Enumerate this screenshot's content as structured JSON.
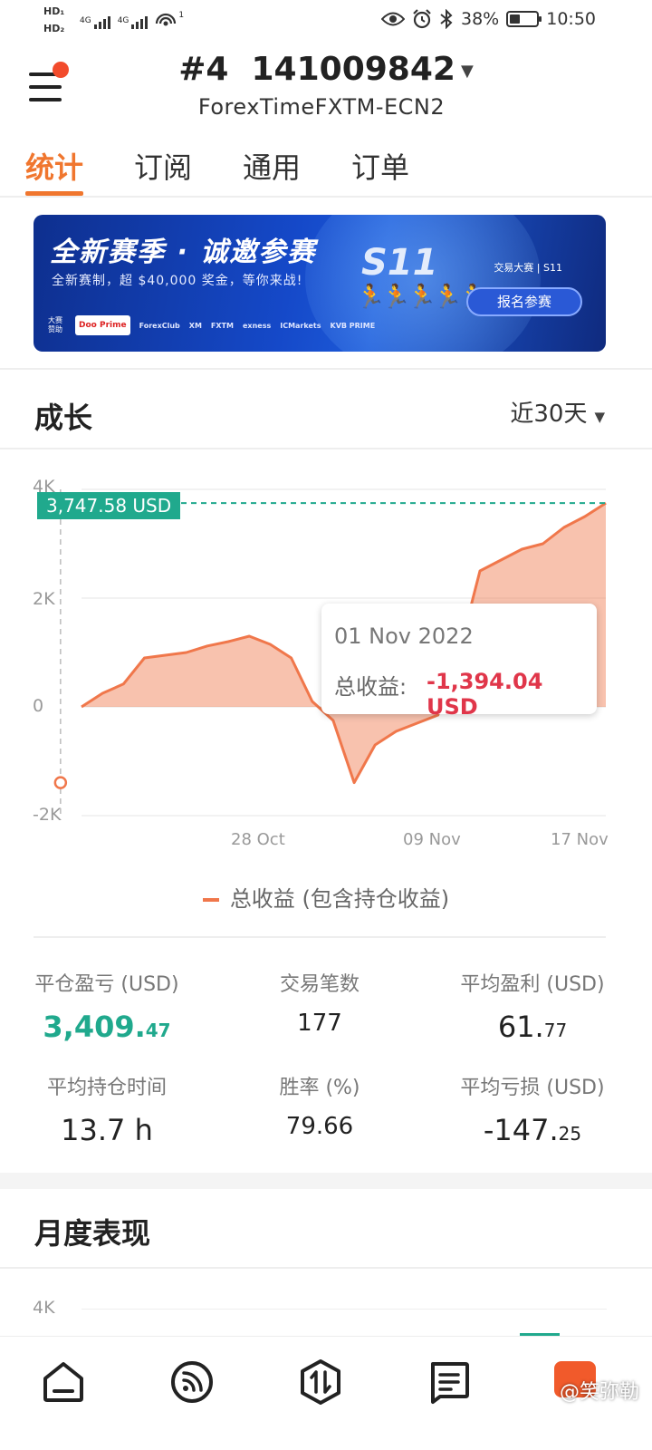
{
  "status_bar": {
    "hd1": "HD₁",
    "hd2": "HD₂",
    "net1": "4G",
    "net2": "4G",
    "hotspot_sup": "1",
    "battery": "38%",
    "time": "10:50",
    "battery_level": 0.38
  },
  "header": {
    "account_title": "#4  141009842",
    "server": "ForexTimeFXTM-ECN2"
  },
  "tabs": [
    {
      "label": "统计"
    },
    {
      "label": "订阅"
    },
    {
      "label": "通用"
    },
    {
      "label": "订单"
    }
  ],
  "banner": {
    "title": "全新赛季 · 诚邀参赛",
    "subtitle": "全新赛制，超 $40,000 奖金，等你来战!",
    "season": "S11",
    "brand": "交易大赛 | S11",
    "cta": "报名参赛",
    "sponsor_label": "大赛赞助",
    "sponsors": [
      "Doo Prime",
      "ForexClub",
      "XM",
      "FXTM",
      "exness",
      "ICMarkets",
      "KVB PRIME"
    ]
  },
  "growth": {
    "title": "成长",
    "period": "近30天",
    "current_value_pill": "3,747.58 USD",
    "tooltip": {
      "date": "01 Nov 2022",
      "label": "总收益:",
      "value": "-1,394.04 USD"
    },
    "legend": "总收益 (包含持仓收益)"
  },
  "chart_data": {
    "type": "area",
    "title": "",
    "series": [
      {
        "name": "总收益 (包含持仓收益)",
        "color": "#f0774b",
        "values": [
          0,
          250,
          420,
          900,
          950,
          1000,
          1120,
          1200,
          1300,
          1150,
          900,
          100,
          -250,
          -1394,
          -700,
          -450,
          -300,
          -150,
          1000,
          2500,
          2700,
          2900,
          3000,
          3300,
          3500,
          3747.58
        ]
      }
    ],
    "x_tick_labels": [
      "28 Oct",
      "09 Nov",
      "17 Nov"
    ],
    "y_ticks": [
      "4K",
      "2K",
      "0",
      "-2K"
    ],
    "ylim": [
      -2000,
      4000
    ],
    "reference_line": 3747.58,
    "highlight": {
      "date": "01 Nov 2022",
      "value": -1394.04
    },
    "grid": true
  },
  "stats": [
    {
      "label": "平仓盈亏 (USD)",
      "int": "3,409.",
      "dec": "47",
      "highlight": true
    },
    {
      "label": "交易笔数",
      "int": "177",
      "dec": ""
    },
    {
      "label": "平均盈利 (USD)",
      "int": "61.",
      "dec": "77"
    },
    {
      "label": "平均持仓时间",
      "int": "13.7 h",
      "dec": ""
    },
    {
      "label": "胜率 (%)",
      "int": "79.66",
      "dec": ""
    },
    {
      "label": "平均亏损 (USD)",
      "int": "-147.",
      "dec": "25"
    }
  ],
  "monthly": {
    "title": "月度表现",
    "y_tick_top": "4K"
  },
  "watermark": "@笑弥勒",
  "colors": {
    "accent": "#f0762e",
    "positive": "#20a98d",
    "negative": "#e0364a",
    "area": "#f0774b"
  },
  "bottom_nav": [
    {
      "icon": "home-icon"
    },
    {
      "icon": "signal-icon"
    },
    {
      "icon": "trade-icon"
    },
    {
      "icon": "list-icon"
    },
    {
      "icon": "profile-icon"
    }
  ]
}
